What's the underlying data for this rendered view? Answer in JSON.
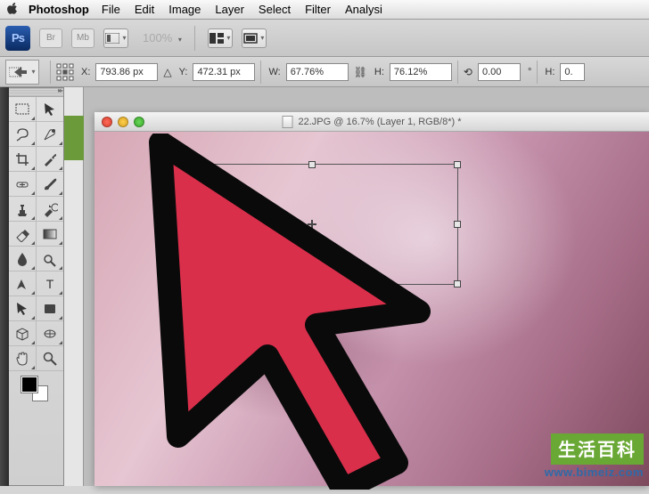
{
  "menubar": {
    "app": "Photoshop",
    "items": [
      "File",
      "Edit",
      "Image",
      "Layer",
      "Select",
      "Filter",
      "Analysi"
    ]
  },
  "strip": {
    "br_label": "Br",
    "mb_label": "Mb",
    "zoom": "100%"
  },
  "options": {
    "x_label": "X:",
    "x_value": "793.86 px",
    "y_label": "Y:",
    "y_value": "472.31 px",
    "w_label": "W:",
    "w_value": "67.76%",
    "h_label": "H:",
    "h_value": "76.12%",
    "rot_value": "0.00",
    "rot_unit": "°",
    "skew_h_label": "H:",
    "skew_h_value": "0."
  },
  "document": {
    "title": "22.JPG @ 16.7% (Layer 1, RGB/8*) *"
  },
  "watermark": {
    "cn": "生活百科",
    "url": "www.bimeiz.com"
  },
  "tool_icons": {
    "marquee": "▭",
    "move": "↖",
    "lasso": "◯",
    "magicwand": "✧",
    "crop": "▦",
    "eyedropper": "◐",
    "heal": "◍",
    "brush": "✎",
    "stamp": "⎈",
    "history": "↺",
    "eraser": "▱",
    "gradient": "▤",
    "blur": "◉",
    "dodge": "◑",
    "pen": "✒",
    "type": "T",
    "path": "↗",
    "shape": "▭",
    "notes": "✎",
    "eyedrop2": "✋",
    "hand": "✋",
    "zoomtool": "🔍"
  }
}
